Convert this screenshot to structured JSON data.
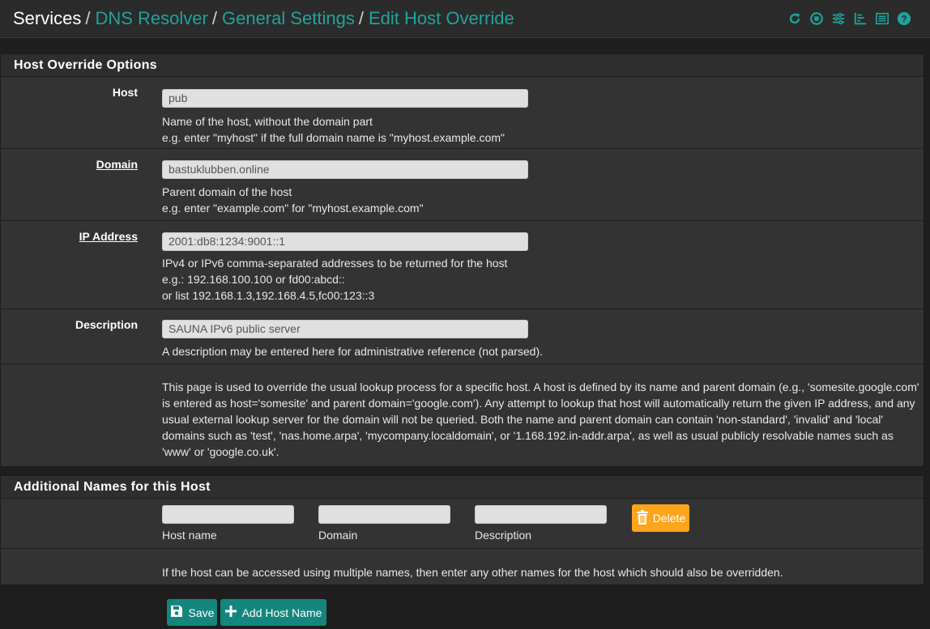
{
  "header": {
    "breadcrumb": {
      "root": "Services",
      "links": [
        "DNS Resolver",
        "General Settings",
        "Edit Host Override"
      ]
    },
    "icons": [
      "restart-icon",
      "stop-icon",
      "settings-icon",
      "chart-icon",
      "list-icon",
      "help-icon"
    ],
    "accent_color": "#20a39a"
  },
  "host_override": {
    "title": "Host Override Options",
    "host": {
      "label": "Host",
      "value": "pub",
      "help1": "Name of the host, without the domain part",
      "help2": "e.g. enter \"myhost\" if the full domain name is \"myhost.example.com\""
    },
    "domain": {
      "label": "Domain",
      "value": "bastuklubben.online",
      "help1": "Parent domain of the host",
      "help2": "e.g. enter \"example.com\" for \"myhost.example.com\""
    },
    "ip": {
      "label": "IP Address",
      "value": "2001:db8:1234:9001::1",
      "help1": "IPv4 or IPv6 comma-separated addresses to be returned for the host",
      "help2": "e.g.: 192.168.100.100 or fd00:abcd::",
      "help3": "or list 192.168.1.3,192.168.4.5,fc00:123::3"
    },
    "description": {
      "label": "Description",
      "value": "SAUNA IPv6 public server",
      "help1": "A description may be entered here for administrative reference (not parsed)."
    },
    "note": "This page is used to override the usual lookup process for a specific host. A host is defined by its name and parent domain (e.g., 'somesite.google.com' is entered as host='somesite' and parent domain='google.com'). Any attempt to lookup that host will automatically return the given IP address, and any usual external lookup server for the domain will not be queried. Both the name and parent domain can contain 'non-standard', 'invalid' and 'local' domains such as 'test', 'nas.home.arpa', 'mycompany.localdomain', or '1.168.192.in-addr.arpa', as well as usual publicly resolvable names such as 'www' or 'google.co.uk'."
  },
  "additional_names": {
    "title": "Additional Names for this Host",
    "host_name_label": "Host name",
    "domain_label": "Domain",
    "description_label": "Description",
    "host_name_value": "",
    "domain_value": "",
    "description_value": "",
    "delete_label": "Delete",
    "delete_color": "#ffa41b",
    "note": "If the host can be accessed using multiple names, then enter any other names for the host which should also be overridden."
  },
  "actions": {
    "save_label": "Save",
    "add_host_label": "Add Host Name",
    "button_color": "#14867d"
  }
}
